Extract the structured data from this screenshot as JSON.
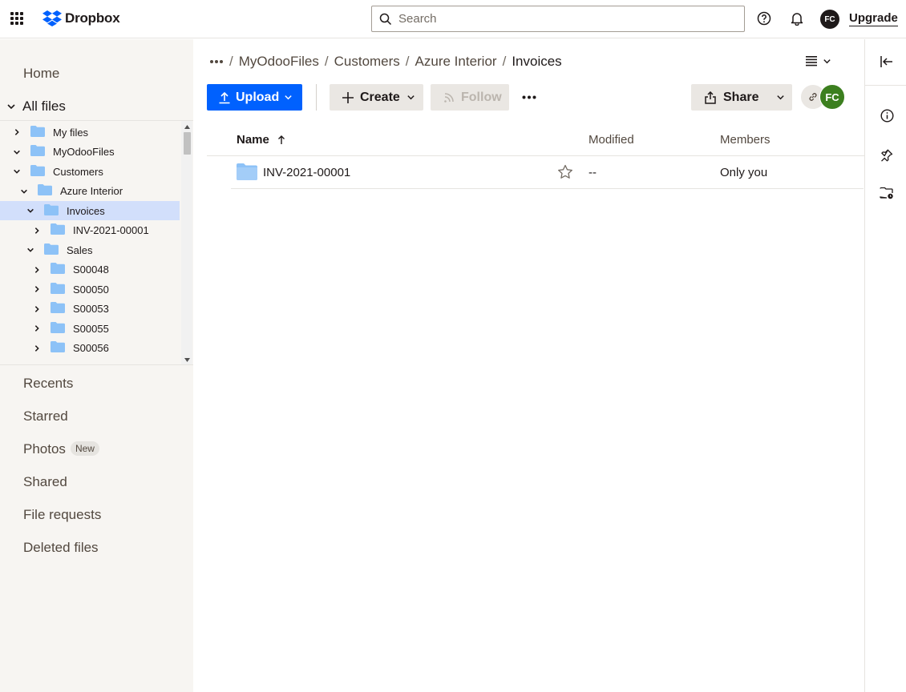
{
  "app": {
    "name": "Dropbox"
  },
  "topbar": {
    "search_placeholder": "Search",
    "avatar_initials": "FC",
    "upgrade_label": "Upgrade"
  },
  "sidebar": {
    "home": "Home",
    "all_files": "All files",
    "tree": [
      {
        "label": "My files",
        "depth": 0,
        "expanded": false,
        "selected": false
      },
      {
        "label": "MyOdooFiles",
        "depth": 0,
        "expanded": true,
        "selected": false
      },
      {
        "label": "Customers",
        "depth": 1,
        "expanded": true,
        "selected": false
      },
      {
        "label": "Azure Interior",
        "depth": 2,
        "expanded": true,
        "selected": false
      },
      {
        "label": "Invoices",
        "depth": 3,
        "expanded": true,
        "selected": true
      },
      {
        "label": "INV-2021-00001",
        "depth": 4,
        "expanded": false,
        "selected": false
      },
      {
        "label": "Sales",
        "depth": 3,
        "expanded": true,
        "selected": false
      },
      {
        "label": "S00048",
        "depth": 4,
        "expanded": false,
        "selected": false
      },
      {
        "label": "S00050",
        "depth": 4,
        "expanded": false,
        "selected": false
      },
      {
        "label": "S00053",
        "depth": 4,
        "expanded": false,
        "selected": false
      },
      {
        "label": "S00055",
        "depth": 4,
        "expanded": false,
        "selected": false
      },
      {
        "label": "S00056",
        "depth": 4,
        "expanded": false,
        "selected": false
      }
    ],
    "recents": "Recents",
    "starred": "Starred",
    "photos": "Photos",
    "photos_badge": "New",
    "shared": "Shared",
    "file_requests": "File requests",
    "deleted_files": "Deleted files"
  },
  "breadcrumb": {
    "items": [
      "MyOdooFiles",
      "Customers",
      "Azure Interior"
    ],
    "current": "Invoices"
  },
  "toolbar": {
    "upload_label": "Upload",
    "create_label": "Create",
    "follow_label": "Follow",
    "share_label": "Share",
    "member_initials": "FC"
  },
  "table": {
    "headers": {
      "name": "Name",
      "modified": "Modified",
      "members": "Members"
    },
    "rows": [
      {
        "name": "INV-2021-00001",
        "modified": "--",
        "members": "Only you"
      }
    ]
  },
  "colors": {
    "accent": "#0061fe",
    "folder": "#8dc2f7",
    "selected": "#d2dffb",
    "member": "#3c7f1f"
  }
}
